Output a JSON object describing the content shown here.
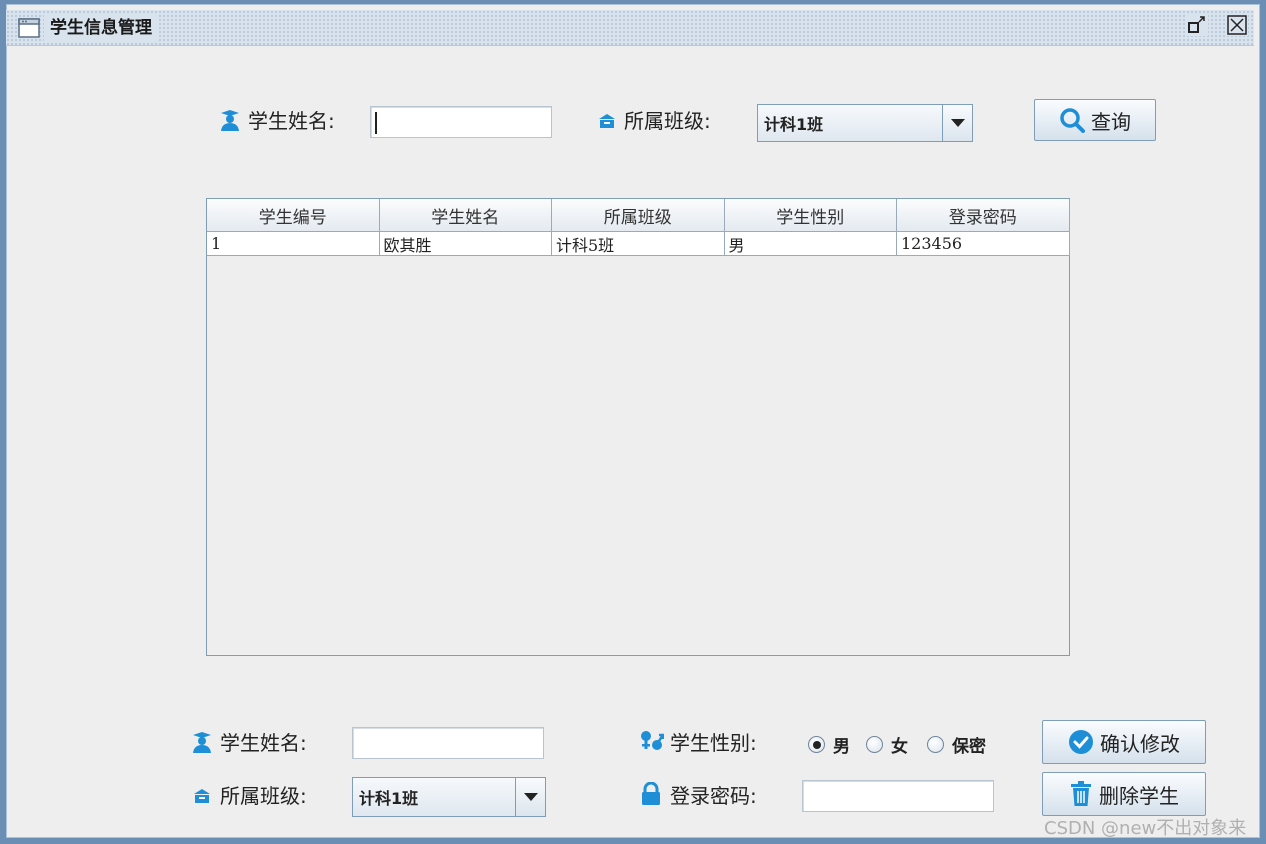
{
  "window": {
    "title": "学生信息管理"
  },
  "search": {
    "name_label": "学生姓名:",
    "name_value": "",
    "class_label": "所属班级:",
    "class_selected": "计科1班",
    "query_button": "查询"
  },
  "table": {
    "columns": [
      "学生编号",
      "学生姓名",
      "所属班级",
      "学生性别",
      "登录密码"
    ],
    "rows": [
      [
        "1",
        "欧其胜",
        "计科5班",
        "男",
        "123456"
      ]
    ]
  },
  "edit": {
    "name_label": "学生姓名:",
    "name_value": "",
    "class_label": "所属班级:",
    "class_selected": "计科1班",
    "gender_label": "学生性别:",
    "gender_options": [
      "男",
      "女",
      "保密"
    ],
    "gender_selected": "男",
    "password_label": "登录密码:",
    "password_value": "",
    "confirm_button": "确认修改",
    "delete_button": "删除学生"
  },
  "watermark": "CSDN @new不出对象来",
  "colors": {
    "accent": "#1e8fd6",
    "border": "#7f9db9"
  }
}
